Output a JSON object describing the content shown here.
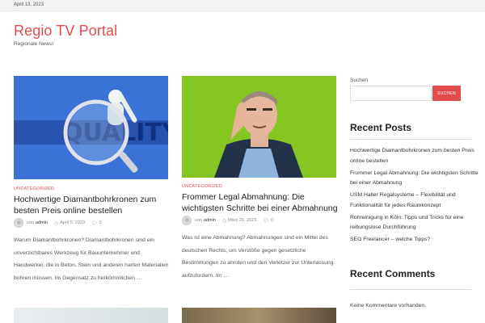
{
  "topbar": {
    "date": "April 13, 2023"
  },
  "site": {
    "title": "Regio TV Portal",
    "tagline": "Regionale News!"
  },
  "posts": [
    {
      "category": "UNCATEGORIZED",
      "title": "Hochwertige Diamantbohrkronen zum besten Preis online bestellen",
      "by": "von",
      "author": "admin",
      "date": "April 5, 2023",
      "comments": "0",
      "excerpt": "Warum Diamantbohrkronen? Diamantbohrkronen sind ein unverzichtbares Werkzeug für Bauunternehmer und Handwerker, die in Beton, Stein und anderen harten Materialien bohren müssen. Im Gegensatz zu herkömmlichen …",
      "image_text": "QUALITY"
    },
    {
      "category": "UNCATEGORIZED",
      "title": "Frommer Legal Abmahnung: Die wichtigsten Schritte bei einer Abmahnung",
      "by": "von",
      "author": "admin",
      "date": "März 20, 2023",
      "comments": "0",
      "excerpt": "Was ist eine Abmahnung? Abmahnungen sind ein Mittel des deutschen Rechts, um Verstöße gegen gesetzliche Bestimmungen zu ahnden und den Verletzer zur Unterlassung aufzufordern. Im …"
    }
  ],
  "sidebar": {
    "search_label": "Suchen",
    "search_placeholder": "",
    "search_button": "SUCHEN",
    "recent_posts_heading": "Recent Posts",
    "recent_posts": [
      "Hochwertige Diamantbohrkronen zum besten Preis online bestellen",
      "Frommer Legal Abmahnung: Die wichtigsten Schritte bei einer Abmahnung",
      "USM Haller Regalsysteme – Flexibilität und Funktionalität für jedes Raumkonzept",
      "Rohreinigung in Köln: Tipps und Tricks für eine reibungslose Durchführung",
      "SEO Freelancer – welche Tipps?"
    ],
    "recent_comments_heading": "Recent Comments",
    "no_comments": "Keine Kommentare vorhanden."
  },
  "colors": {
    "accent": "#e34c4c"
  },
  "icons": {
    "clock": "clock-icon",
    "comment": "comment-icon",
    "avatar": "avatar"
  }
}
